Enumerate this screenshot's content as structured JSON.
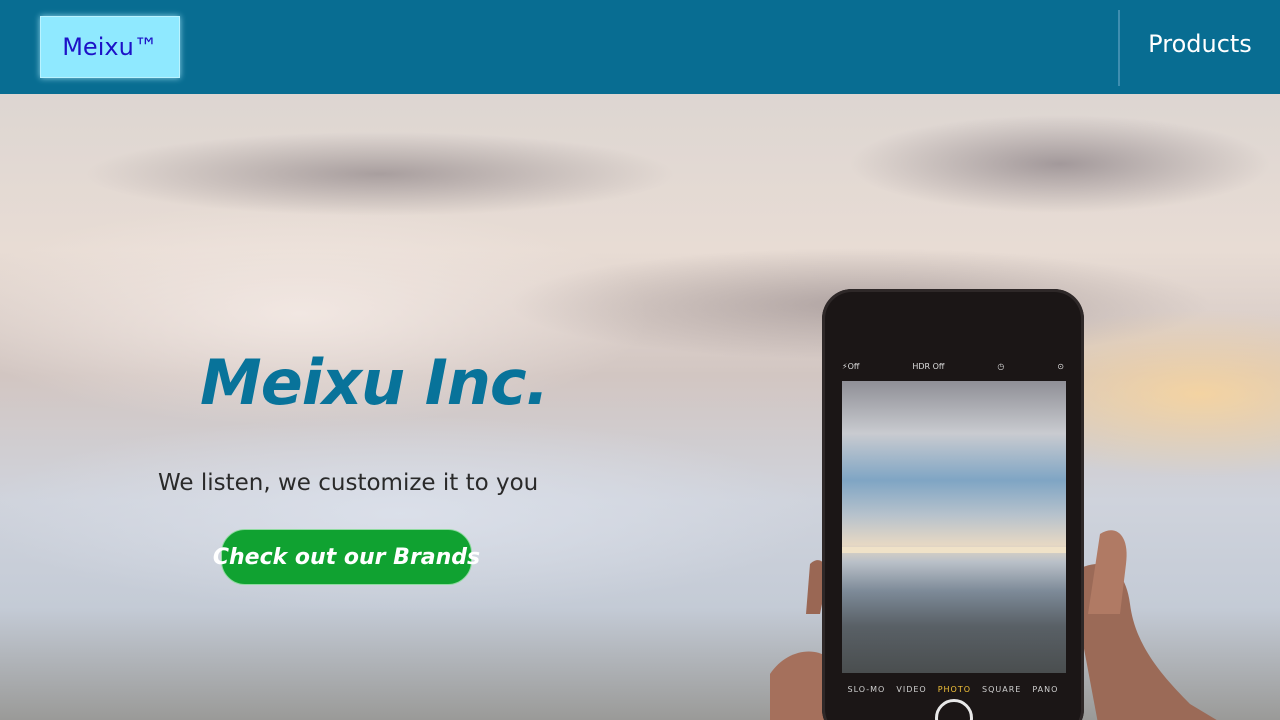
{
  "nav": {
    "brand": "Meixu™",
    "products": "Products"
  },
  "hero": {
    "title": "Meixu  Inc.",
    "tagline": "We listen, we customize it to you",
    "cta": "Check out our Brands"
  },
  "phone": {
    "flash": "⚡Off",
    "hdr": "HDR Off",
    "modes": [
      "SLO-MO",
      "VIDEO",
      "PHOTO",
      "SQUARE",
      "PANO"
    ],
    "active_mode": "PHOTO"
  },
  "colors": {
    "navbar": "#086d92",
    "brand_bg": "#8fe9ff",
    "brand_text": "#1d12c7",
    "title": "#08739a",
    "cta": "#10a231"
  },
  "icons": {
    "timer": "timer-icon",
    "camera_flip": "camera-flip-icon"
  }
}
